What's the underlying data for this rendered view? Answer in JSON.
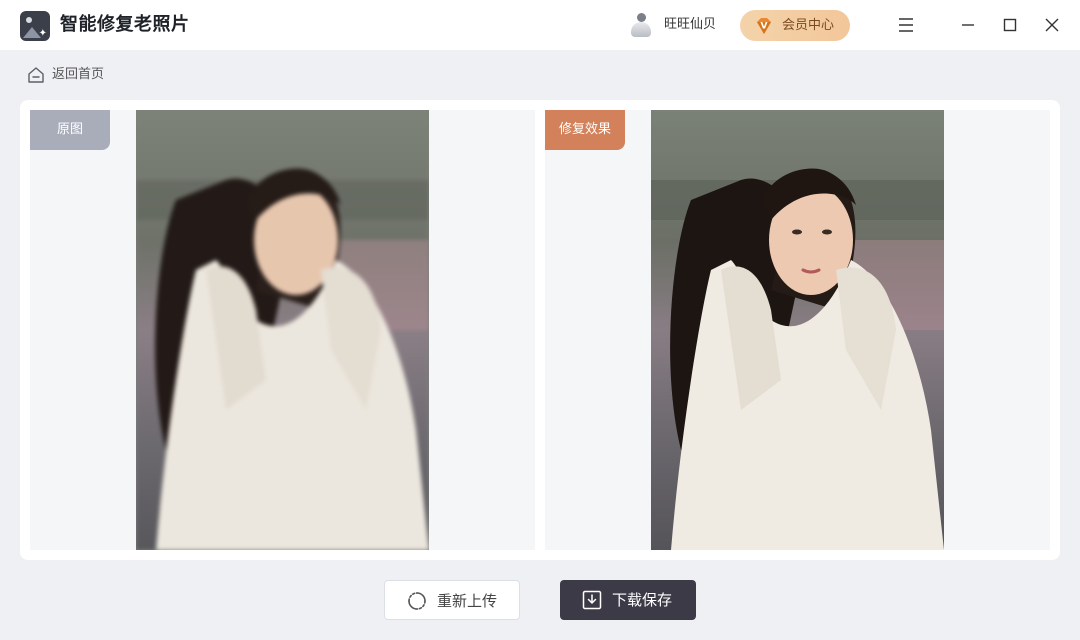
{
  "app": {
    "title": "智能修复老照片"
  },
  "user": {
    "name": "旺旺仙贝",
    "vip_label": "会员中心",
    "vip_badge": "V"
  },
  "nav": {
    "back_label": "返回首页"
  },
  "compare": {
    "original_label": "原图",
    "result_label": "修复效果"
  },
  "actions": {
    "reupload_label": "重新上传",
    "save_label": "下载保存"
  },
  "icons": {
    "logo": "photo-repair-logo-icon",
    "avatar": "user-avatar-icon",
    "vip": "vip-diamond-icon",
    "menu": "hamburger-menu-icon",
    "minimize": "minimize-icon",
    "maximize": "maximize-icon",
    "close": "close-icon",
    "home": "home-icon",
    "reupload": "refresh-icon",
    "download": "download-icon"
  },
  "colors": {
    "accent_dark": "#3d3a47",
    "result_tag": "#d3815a",
    "original_tag": "#a9adba",
    "vip_gold": "#f2c79a"
  }
}
